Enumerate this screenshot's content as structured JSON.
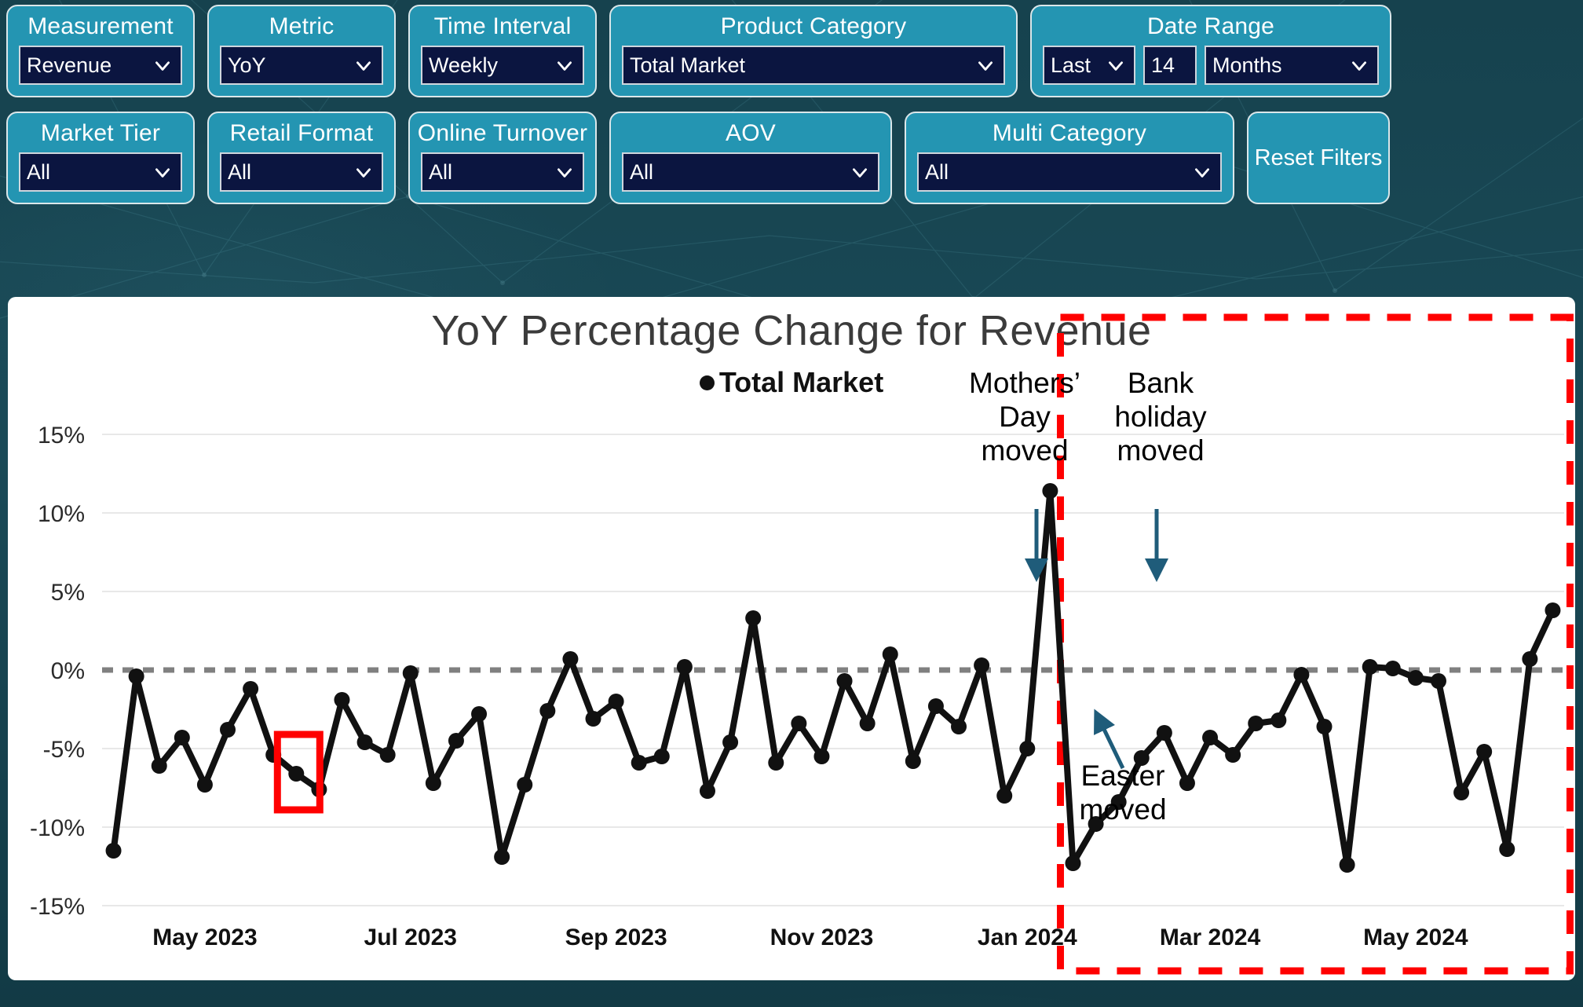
{
  "filters": {
    "row1": [
      {
        "id": "measurement",
        "title": "Measurement",
        "value": "Revenue",
        "icon": "chevron-down-icon"
      },
      {
        "id": "metric",
        "title": "Metric",
        "value": "YoY",
        "icon": "chevron-down-icon"
      },
      {
        "id": "time-interval",
        "title": "Time Interval",
        "value": "Weekly",
        "icon": "chevron-down-icon"
      },
      {
        "id": "product-category",
        "title": "Product Category",
        "value": "Total Market",
        "icon": "chevron-down-icon"
      }
    ],
    "date_range": {
      "title": "Date Range",
      "mode": "Last",
      "count": "14",
      "unit": "Months"
    },
    "row2": [
      {
        "id": "market-tier",
        "title": "Market Tier",
        "value": "All",
        "icon": "chevron-down-icon"
      },
      {
        "id": "retail-format",
        "title": "Retail Format",
        "value": "All",
        "icon": "chevron-down-icon"
      },
      {
        "id": "online-turnover",
        "title": "Online Turnover",
        "value": "All",
        "icon": "chevron-down-icon"
      },
      {
        "id": "aov",
        "title": "AOV",
        "value": "All",
        "icon": "chevron-down-icon"
      },
      {
        "id": "multi-category",
        "title": "Multi Category",
        "value": "All",
        "icon": "chevron-down-icon"
      }
    ],
    "reset_label": "Reset Filters"
  },
  "colors": {
    "panel_teal": "#2495b2",
    "dropdown_navy": "#0b1540",
    "background_dark": "#1a4a57",
    "series_black": "#111111",
    "highlight_red": "#FF0000",
    "arrow_blue": "#1F5C7A",
    "zero_line_gray": "#808080"
  },
  "chart_data": {
    "type": "line",
    "title": "YoY Percentage Change for Revenue",
    "xlabel": "",
    "ylabel": "",
    "ylim": [
      -15,
      15
    ],
    "ytick_values": [
      15,
      10,
      5,
      0,
      -5,
      -10,
      -15
    ],
    "ytick_labels": [
      "15%",
      "10%",
      "5%",
      "0%",
      "-5%",
      "-10%",
      "-15%"
    ],
    "xtick_labels": [
      "May 2023",
      "Jul 2023",
      "Sep 2023",
      "Nov 2023",
      "Jan 2024",
      "Mar 2024",
      "May 2024"
    ],
    "xtick_indices": [
      4,
      13,
      22,
      31,
      40,
      48,
      57
    ],
    "grid": true,
    "zero_reference_line": true,
    "legend": {
      "position": "top-center",
      "entries": [
        "Total Market"
      ]
    },
    "series": [
      {
        "name": "Total Market",
        "marker": "circle",
        "color": "#111111",
        "values": [
          -11.5,
          -0.4,
          -6.1,
          -4.3,
          -7.3,
          -3.8,
          -1.2,
          -5.4,
          -6.6,
          -7.6,
          -1.9,
          -4.6,
          -5.4,
          -0.2,
          -7.2,
          -4.5,
          -2.8,
          -11.9,
          -7.3,
          -2.6,
          0.7,
          -3.1,
          -2.0,
          -5.9,
          -5.5,
          0.2,
          -7.7,
          -4.6,
          3.3,
          -5.9,
          -3.4,
          -5.5,
          -0.7,
          -3.4,
          1.0,
          -5.8,
          -2.3,
          -3.6,
          0.3,
          -8.0,
          -5.0,
          11.4,
          -12.3,
          -9.8,
          -8.4,
          -5.6,
          -4.0,
          -7.2,
          -4.3,
          -5.4,
          -3.4,
          -3.2,
          -0.3,
          -3.6,
          -12.4,
          0.2,
          0.1,
          -0.5,
          -0.7,
          -7.8,
          -5.2,
          -11.4,
          0.7,
          3.8
        ]
      }
    ],
    "annotations": [
      {
        "id": "mothers-day",
        "text": "Mothers’ Day moved",
        "lines": [
          "Mothers’",
          "Day",
          "moved"
        ],
        "arrow": "down",
        "target_index": 54
      },
      {
        "id": "bank-holiday",
        "text": "Bank holiday moved",
        "lines": [
          "Bank",
          "holiday",
          "moved"
        ],
        "arrow": "down",
        "target_index": 61
      },
      {
        "id": "easter-moved",
        "text": "Easter moved",
        "lines": [
          "Easter",
          "moved"
        ],
        "arrow": "up-left",
        "target_index": 59
      }
    ],
    "highlight_boxes": [
      {
        "id": "red-point-highlight",
        "type": "solid",
        "color": "#FF0000",
        "target_index": 8,
        "note": "small red rectangle around data point"
      },
      {
        "id": "red-region-2024",
        "type": "dashed",
        "color": "#FF0000",
        "from_index": 42,
        "to_index": 63,
        "note": "dashed red region covering 2024 period"
      }
    ]
  }
}
